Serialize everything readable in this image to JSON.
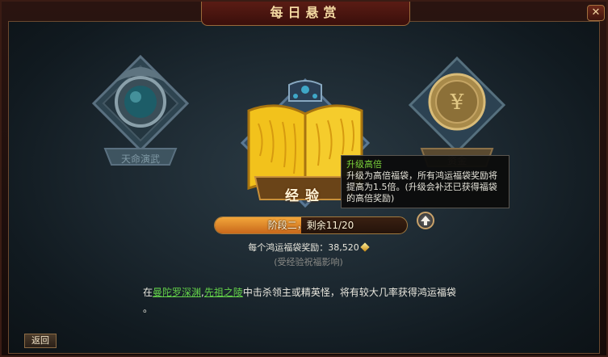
{
  "window": {
    "title": "每日悬赏",
    "close_label": "✕"
  },
  "cards": {
    "left": {
      "label": "天命演武"
    },
    "center": {
      "label": "经验"
    },
    "right": {
      "label": "资金"
    }
  },
  "tooltip": {
    "title": "升级高倍",
    "body": "升级为高倍福袋，所有鸿运福袋奖励将提高为1.5倍。(升级会补还已获得福袋的高倍奖励)"
  },
  "stage": {
    "text": "阶段二，剩余11/20",
    "progress": 0.45
  },
  "reward": {
    "text": "每个鸿运福袋奖励：38,520",
    "icon": "gold-ingot-icon"
  },
  "note": "(受经验祝福影响)",
  "description": {
    "prefix": "在",
    "link1": "曼陀罗深渊",
    "sep": ",",
    "link2": "先祖之陵",
    "suffix": "中击杀领主或精英怪，将有较大几率获得鸿运福袋",
    "end": "。"
  },
  "back_label": "返回",
  "colors": {
    "accent": "#f2a63a",
    "link": "#63d14a",
    "tip_title": "#7bd43b"
  }
}
